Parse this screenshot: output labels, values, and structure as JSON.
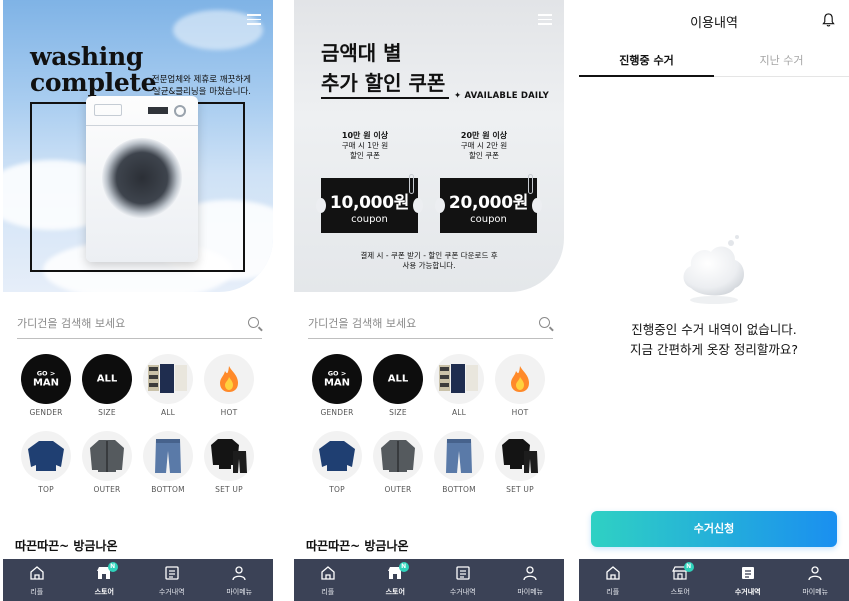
{
  "screens": [
    {
      "banner": {
        "title_line1": "washing",
        "title_line2": "complete",
        "subtitle_line1": "전문업체와 제휴로 깨끗하게",
        "subtitle_line2": "살균&클리닝을 마쳤습니다."
      },
      "search_placeholder": "가디건을 검색해 보세요",
      "section_title": "따끈따끈~ 방금나온"
    },
    {
      "banner": {
        "title_line1": "금액대 별",
        "title_line2": "추가 할인 쿠폰",
        "available": "✦ AVAILABLE DAILY",
        "coupons": [
          {
            "cond_1": "10만 원 이상",
            "cond_2": "구매 시 1만 원",
            "cond_3": "할인 쿠폰",
            "amount": "10,000원",
            "label": "coupon"
          },
          {
            "cond_1": "20만 원 이상",
            "cond_2": "구매 시 2만 원",
            "cond_3": "할인 쿠폰",
            "amount": "20,000원",
            "label": "coupon"
          }
        ],
        "note_line1": "결제 시 - 쿠폰 받기 - 할인 쿠폰 다운로드 후",
        "note_line2": "사용 가능합니다."
      },
      "search_placeholder": "가디건을 검색해 보세요",
      "section_title": "따끈따끈~ 방금나온"
    }
  ],
  "categories": [
    {
      "top": "GO >",
      "main": "MAN",
      "caption": "GENDER"
    },
    {
      "main": "ALL",
      "caption": "SIZE"
    },
    {
      "caption": "ALL"
    },
    {
      "caption": "HOT"
    },
    {
      "caption": "TOP"
    },
    {
      "caption": "OUTER"
    },
    {
      "caption": "BOTTOM"
    },
    {
      "caption": "SET UP"
    }
  ],
  "nav": {
    "items": [
      "리플",
      "스토어",
      "수거내역",
      "마이메뉴"
    ],
    "badge": "N"
  },
  "history": {
    "title": "이용내역",
    "tab_active": "진행중 수거",
    "tab_inactive": "지난 수거",
    "empty_line1": "진행중인 수거 내역이 없습니다.",
    "empty_line2": "지금 간편하게 옷장 정리할까요?",
    "cta": "수거신청"
  },
  "colors": {
    "nav_bg": "#3b4256",
    "badge": "#2fd2bb",
    "cta_start": "#2fd1c3",
    "cta_end": "#1a8ff0"
  }
}
